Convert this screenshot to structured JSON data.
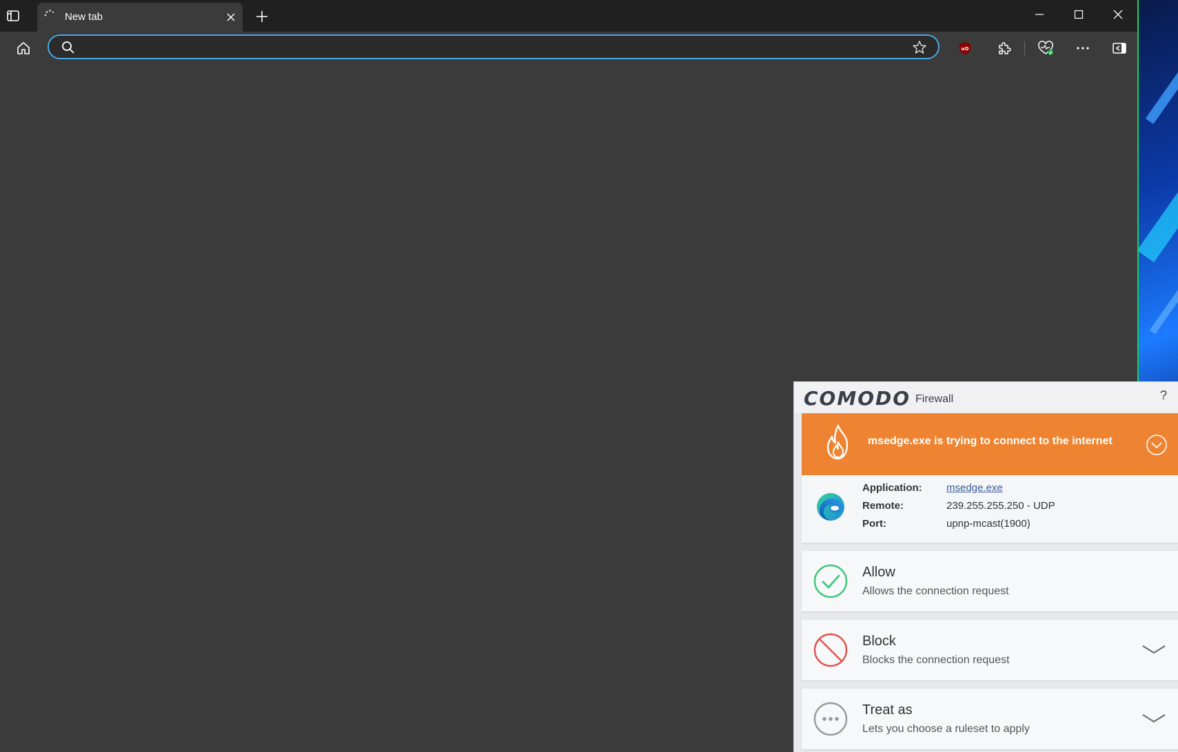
{
  "browser": {
    "tab": {
      "title": "New tab"
    },
    "address": {
      "value": "",
      "placeholder": ""
    }
  },
  "comodo": {
    "brand": "COMODO",
    "product": "Firewall",
    "help": "?",
    "alert": {
      "message": "msedge.exe is trying to connect to the internet"
    },
    "info": {
      "application_label": "Application:",
      "application_value": "msedge.exe",
      "remote_label": "Remote:",
      "remote_value": "239.255.255.250 - UDP",
      "port_label": "Port:",
      "port_value": "upnp-mcast(1900)"
    },
    "options": [
      {
        "title": "Allow",
        "description": "Allows the connection request"
      },
      {
        "title": "Block",
        "description": "Blocks the connection request"
      },
      {
        "title": "Treat as",
        "description": "Lets you choose a ruleset to apply"
      }
    ],
    "colors": {
      "alert": "#ee8432",
      "allow": "#3cc77a",
      "block": "#e2514c",
      "treat": "#9a9a9a"
    }
  },
  "icons": [
    "tab-actions-icon",
    "loading-spinner-icon",
    "close-icon",
    "plus-icon",
    "minimize-icon",
    "maximize-icon",
    "close-window-icon",
    "home-icon",
    "search-icon",
    "star-icon",
    "ublock-icon",
    "extensions-icon",
    "browser-essentials-icon",
    "more-icon",
    "sidebar-icon",
    "flame-icon",
    "chevron-down-circle-icon",
    "edge-icon",
    "check-icon",
    "block-icon",
    "dots-icon",
    "chevron-down-icon"
  ]
}
